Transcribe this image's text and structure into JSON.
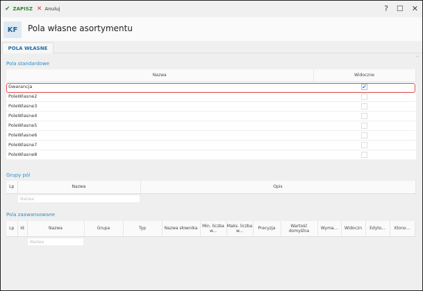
{
  "toolbar": {
    "save_label": "ZAPISZ",
    "cancel_label": "Anuluj",
    "help": "?",
    "maximize": "☐",
    "close": "✕"
  },
  "header": {
    "badge": "KF",
    "title": "Pola własne asortymentu"
  },
  "tabs": [
    {
      "label": "POLA WŁASNE",
      "active": true
    }
  ],
  "standard": {
    "title": "Pola standardowe",
    "columns": [
      "Nazwa",
      "Widoczne"
    ],
    "rows": [
      {
        "name": "Gwarancja",
        "visible": true
      },
      {
        "name": "PoleWlasne2",
        "visible": false
      },
      {
        "name": "PoleWlasne3",
        "visible": false
      },
      {
        "name": "PoleWlasne4",
        "visible": false
      },
      {
        "name": "PoleWlasne5",
        "visible": false
      },
      {
        "name": "PoleWlasne6",
        "visible": false
      },
      {
        "name": "PoleWlasne7",
        "visible": false
      },
      {
        "name": "PoleWlasne8",
        "visible": false
      }
    ]
  },
  "groups": {
    "title": "Grupy pól",
    "columns": [
      "Lp",
      "Nazwa",
      "Opis"
    ],
    "filter_placeholder": "Nazwa"
  },
  "advanced": {
    "title": "Pola zaawansowane",
    "columns": [
      "Lp",
      "Id",
      "Nazwa",
      "Grupa",
      "Typ",
      "Nazwa słownika",
      "Min. liczba w...",
      "Maks. liczba w...",
      "Precyzja",
      "Wartość domyślna",
      "Wyma...",
      "Widoczn",
      "Edyto...",
      "Klono..."
    ],
    "filter_placeholder": "Nazwa"
  }
}
